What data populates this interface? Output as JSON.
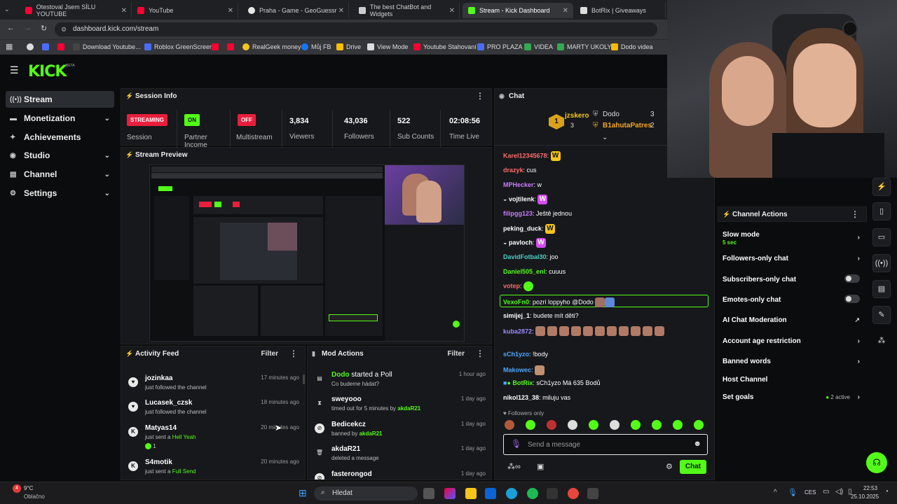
{
  "browser": {
    "tabs": [
      {
        "title": "Otestoval Jsem SÍLU YOUTUBE",
        "fav": "#ff0033"
      },
      {
        "title": "YouTube",
        "fav": "#ff0033"
      },
      {
        "title": "Praha - Game - GeoGuessr",
        "fav": "#e8e8e8"
      },
      {
        "title": "The best ChatBot and Widgets",
        "fav": "#cccccc"
      },
      {
        "title": "Stream - Kick Dashboard",
        "fav": "#53fc18"
      },
      {
        "title": "BotRix | Giveaways",
        "fav": "#dddddd"
      }
    ],
    "url": "dashboard.kick.com/stream",
    "bookmarks": [
      "Download Youtube...",
      "Roblox GreenScreen",
      "RealGeek money",
      "Můj FB",
      "Drive",
      "View Mode",
      "Youtube Stahovaní",
      "PRO PLAZA",
      "VIDEA",
      "MARTY UKOLY",
      "Dodo videa"
    ]
  },
  "kick": {
    "logo": "KICK",
    "beta": "BETA"
  },
  "sidebar": {
    "items": [
      {
        "label": "Stream",
        "icon": "stream-icon"
      },
      {
        "label": "Monetization",
        "icon": "money-icon"
      },
      {
        "label": "Achievements",
        "icon": "trophy-icon"
      },
      {
        "label": "Studio",
        "icon": "studio-icon"
      },
      {
        "label": "Channel",
        "icon": "channel-icon"
      },
      {
        "label": "Settings",
        "icon": "gear-icon"
      }
    ]
  },
  "session": {
    "title": "Session Info",
    "streaming_badge": "STREAMING",
    "session_label": "Session",
    "on_badge": "ON",
    "partner_label": "Partner Income",
    "off_badge": "OFF",
    "multistream_label": "Multistream",
    "viewers": "3,834",
    "viewers_label": "Viewers",
    "followers": "43,036",
    "followers_label": "Followers",
    "subs": "522",
    "subs_label": "Sub Counts",
    "time": "02:08:56",
    "time_label": "Time Live"
  },
  "preview": {
    "title": "Stream Preview"
  },
  "activity": {
    "title": "Activity Feed",
    "filter": "Filter",
    "rows": [
      {
        "name": "jozinkaa",
        "sub": "just followed the channel",
        "time": "17 minutes ago",
        "icon": "heart-icon"
      },
      {
        "name": "Lucasek_czsk",
        "sub": "just followed the channel",
        "time": "18 minutes ago",
        "icon": "heart-icon"
      },
      {
        "name": "Matyas14",
        "sub_a": "just sent a ",
        "sub_b": "Hell Yeah",
        "extra": "1",
        "time": "20 minutes ago",
        "icon": "kick-icon"
      },
      {
        "name": "S4motik",
        "sub_a": "just sent a ",
        "sub_b": "Full Send",
        "time": "20 minutes ago",
        "icon": "kick-icon"
      }
    ]
  },
  "mod": {
    "title": "Mod Actions",
    "filter": "Filter",
    "rows": [
      {
        "name": "Dodo",
        "action": " started a Poll",
        "sub": "Co budeme hádat?",
        "time": "1 hour ago",
        "icon": "poll-icon"
      },
      {
        "name": "sweyooo",
        "sub_a": "timed out for 5 minutes by ",
        "sub_b": "akdaR21",
        "time": "1 day ago",
        "icon": "hourglass-icon"
      },
      {
        "name": "Bedicekcz",
        "sub_a": "banned by ",
        "sub_b": "akdaR21",
        "time": "1 day ago",
        "icon": "ban-icon"
      },
      {
        "name": "akdaR21",
        "sub_a": "deleted a message",
        "sub_b": "",
        "time": "1 day ago",
        "icon": "trash-icon"
      },
      {
        "name": "fasterongod",
        "sub_a": "",
        "sub_b": "",
        "time": "1 day ago",
        "icon": "ban-icon"
      }
    ]
  },
  "chat": {
    "title": "Chat",
    "leaders": [
      {
        "rank": "1",
        "name": "jzskero",
        "count": "3"
      },
      {
        "name": "Dodo",
        "count": "3"
      },
      {
        "name": "B1ahutaPatres",
        "count": "2"
      }
    ],
    "messages": [
      {
        "user": "Karel12345678",
        "text": "",
        "color": "#ff6b6b",
        "emote": "W"
      },
      {
        "user": "drazyk",
        "text": "cus",
        "color": "#ff6b6b"
      },
      {
        "user": "MPHecker",
        "text": "w",
        "color": "#c77dff"
      },
      {
        "user": "vojtilenk",
        "text": "",
        "color": "#ffffff",
        "emote": "W"
      },
      {
        "user": "filipgg123",
        "text": "Ještě jednou",
        "color": "#c77dff"
      },
      {
        "user": "peking_duck",
        "text": "",
        "color": "#ffffff",
        "emote": "W"
      },
      {
        "user": "pavloch",
        "text": "",
        "color": "#ffffff",
        "emote": "W"
      },
      {
        "user": "DavidFotbal30",
        "text": "joo",
        "color": "#4ecdc4"
      },
      {
        "user": "Daniel505_enl",
        "text": "cuuus",
        "color": "#53fc18"
      },
      {
        "user": "votep",
        "text": "",
        "color": "#ff6b6b"
      },
      {
        "user": "VexoFn0",
        "text": "pozri loppyho @Dodo",
        "color": "#53fc18"
      },
      {
        "user": "simijej_1",
        "text": "budete mít děti?",
        "color": "#ffffff"
      },
      {
        "user": "kuba2872",
        "text": "",
        "color": "#9b8cff"
      },
      {
        "user": "sCh1yzo",
        "text": "!body",
        "color": "#4ea8ff"
      },
      {
        "user": "Makowec",
        "text": "",
        "color": "#4ea8ff"
      },
      {
        "user": "BotRix",
        "text": "sCh1yzo Má 635 Bodů",
        "color": "#53fc18"
      },
      {
        "user": "nikol123_38",
        "text": "miluju vas",
        "color": "#ffffff"
      }
    ],
    "followers_only": "Followers only",
    "send_placeholder": "Send a message",
    "chat_button": "Chat"
  },
  "channel_actions": {
    "title": "Channel Actions",
    "slow_mode": "Slow mode",
    "slow_mode_value": "5 sec",
    "followers_only": "Followers-only chat",
    "subscribers_only": "Subscribers-only chat",
    "emotes_only": "Emotes-only chat",
    "ai_moderation": "AI Chat Moderation",
    "account_age": "Account age restriction",
    "banned_words": "Banned words",
    "host": "Host Channel",
    "goals": "Set goals",
    "goals_active": "2 active"
  },
  "taskbar": {
    "weather_temp": "9°C",
    "weather_text": "Oblačno",
    "weather_badge": "4",
    "search": "Hledat",
    "lang": "CES",
    "time": "22:53",
    "date": "25.10.2025"
  },
  "colors": {
    "accent": "#53fc18",
    "live_red": "#e91e3c",
    "panel": "#16181b"
  }
}
